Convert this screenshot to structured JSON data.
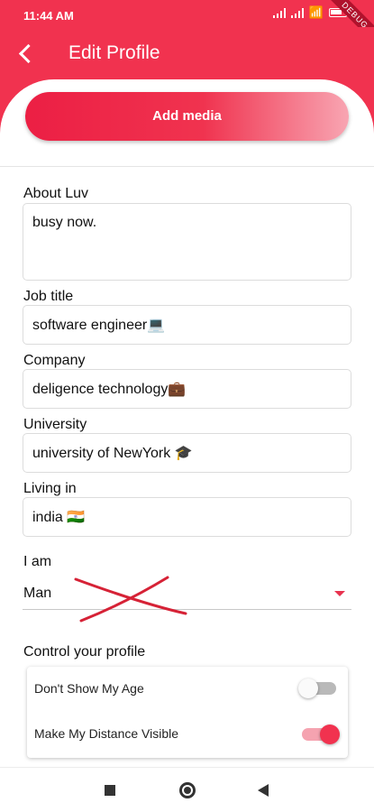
{
  "status_bar": {
    "time": "11:44 AM",
    "battery": "85",
    "debug_label": "DEBUG"
  },
  "app_bar": {
    "title": "Edit Profile"
  },
  "add_media": {
    "label": "Add media"
  },
  "fields": {
    "about": {
      "label": "About Luv",
      "value": "busy now."
    },
    "job_title": {
      "label": "Job title",
      "value": "software engineer💻"
    },
    "company": {
      "label": "Company",
      "value": "deligence technology💼"
    },
    "university": {
      "label": "University",
      "value": "university of NewYork 🎓"
    },
    "living_in": {
      "label": "Living in",
      "value": "india 🇮🇳"
    }
  },
  "gender": {
    "label": "I am",
    "value": "Man"
  },
  "control": {
    "title": "Control your profile",
    "toggles": [
      {
        "label": "Don't Show My Age",
        "on": false
      },
      {
        "label": "Make My Distance Visible",
        "on": true
      }
    ]
  },
  "colors": {
    "accent": "#f1324f",
    "annotation_red": "#d62236"
  }
}
